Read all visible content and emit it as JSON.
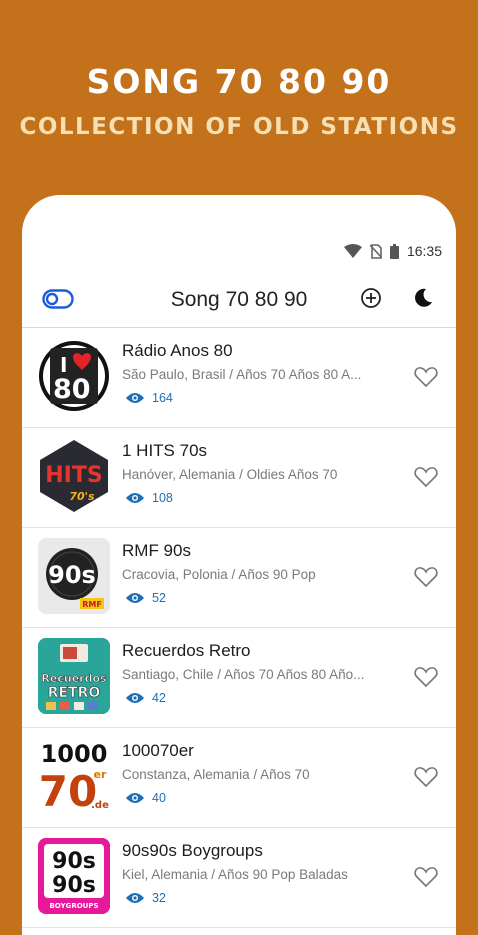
{
  "promo": {
    "title": "SONG 70 80 90",
    "subtitle": "COLLECTION OF OLD STATIONS"
  },
  "statusbar": {
    "time": "16:35"
  },
  "toolbar": {
    "title": "Song 70 80 90"
  },
  "colors": {
    "background": "#c4711c",
    "accent": "#1f6fb5",
    "toggle": "#1e5bd8"
  },
  "stations": [
    {
      "name": "Rádio Anos 80",
      "desc": "São Paulo, Brasil / Años 70 Años 80 A...",
      "views": "164"
    },
    {
      "name": "1 HITS 70s",
      "desc": "Hanóver, Alemania / Oldies Años 70",
      "views": "108"
    },
    {
      "name": "RMF 90s",
      "desc": "Cracovia, Polonia / Años 90 Pop",
      "views": "52"
    },
    {
      "name": "Recuerdos Retro",
      "desc": "Santiago, Chile / Años 70 Años 80 Año...",
      "views": "42"
    },
    {
      "name": "100070er",
      "desc": "Constanza, Alemania / Años 70",
      "views": "40"
    },
    {
      "name": "90s90s Boygroups",
      "desc": "Kiel, Alemania / Años 90 Pop Baladas",
      "views": "32"
    }
  ],
  "logos": {
    "radio_anos_80": {
      "top": "I",
      "main": "80"
    },
    "hits_70s": {
      "main": "HITS",
      "sub": "70's"
    },
    "rmf_90s": {
      "main": "90s",
      "sub": "RMF"
    },
    "recuerdos_retro": {
      "line1": "Recuerdos",
      "line2": "RETRO"
    },
    "er_1000": {
      "top": "1000",
      "main": "70",
      "sup": "er",
      "sub": ".de"
    },
    "boygroups": {
      "line1": "90s",
      "line2": "90s",
      "sub": "BOYGROUPS"
    }
  }
}
